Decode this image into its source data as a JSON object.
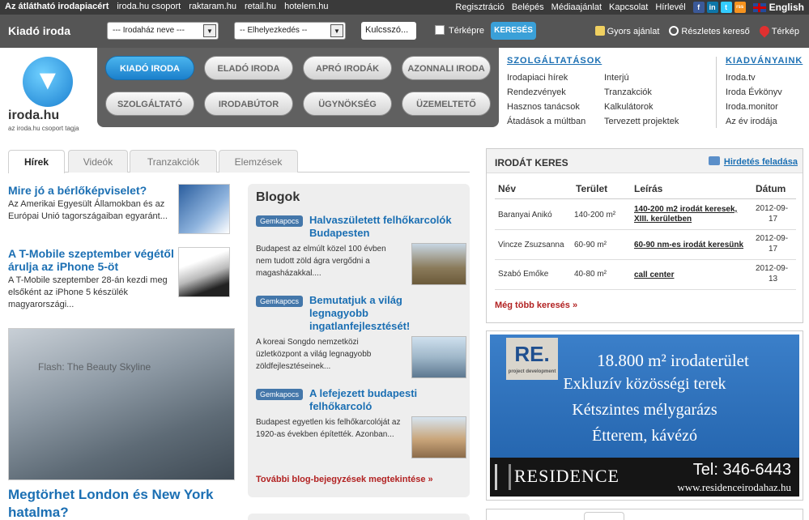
{
  "topbar": {
    "links": [
      "Az átlátható irodapiacért",
      "iroda.hu csoport",
      "raktaram.hu",
      "retail.hu",
      "hotelem.hu"
    ],
    "right": [
      "Regisztráció",
      "Belépés",
      "Médiaajánlat",
      "Kapcsolat",
      "Hírlevél"
    ],
    "social": [
      "f",
      "in",
      "t",
      "rss"
    ],
    "language": "English"
  },
  "searchbar": {
    "brand": "Kiadó iroda",
    "building_select": "--- Irodaház neve ---",
    "location_select": "-- Elhelyezkedés --",
    "keyword_placeholder": "Kulcsszó...",
    "map_checkbox": "Térképre",
    "search_button": "KERESÉS",
    "quick_offer": "Gyors ajánlat",
    "detailed_search": "Részletes kereső",
    "map": "Térkép"
  },
  "logo": {
    "name": "iroda.hu",
    "tagline": "az iroda.hu csoport tagja"
  },
  "nav": [
    "KIADÓ IRODA",
    "ELADÓ IRODA",
    "APRÓ IRODÁK",
    "AZONNALI IRODA",
    "SZOLGÁLTATÓ",
    "IRODABÚTOR",
    "ÜGYNÖKSÉG",
    "ÜZEMELTETŐ"
  ],
  "services": {
    "title": "SZOLGÁLTATÁSOK",
    "col1": [
      "Irodapiaci hírek",
      "Rendezvények",
      "Hasznos tanácsok",
      "Átadások a múltban"
    ],
    "col2": [
      "Interjú",
      "Tranzakciók",
      "Kalkulátorok",
      "Tervezett projektek"
    ]
  },
  "publications": {
    "title": "KIADVÁNYAINK",
    "items": [
      "Iroda.tv",
      "Iroda Évkönyv",
      "Iroda.monitor",
      "Az év irodája"
    ]
  },
  "tabs": [
    "Hírek",
    "Videók",
    "Tranzakciók",
    "Elemzések"
  ],
  "news": [
    {
      "title": "Mire jó a bérlőképviselet?",
      "text": "Az Amerikai Egyesült Államokban és az Európai Unió tagországaiban egyaránt..."
    },
    {
      "title": "A T-Mobile szeptember végétől árulja az iPhone 5-öt",
      "text": "A T-Mobile szeptember 28-án kezdi meg elsőként az iPhone 5 készülék magyarországi..."
    }
  ],
  "big_news": {
    "title": "Megtörhet London és New York hatalma?",
    "image_caption": "Flash: The Beauty Skyline"
  },
  "blog": {
    "heading": "Blogok",
    "tag": "Gemkapocs",
    "items": [
      {
        "title": "Halvaszületett felhőkarcolók Budapesten",
        "text": "Budapest az elmúlt közel 100 évben nem tudott zöld ágra vergődni a magasházakkal...."
      },
      {
        "title": "Bemutatjuk a világ legnagyobb ingatlanfejlesztését!",
        "text": "A koreai Songdo nemzetközi üzletközpont a világ legnagyobb zöldfejlesztéseinek..."
      },
      {
        "title": "A lefejezett budapesti felhőkarcoló",
        "text": "Budapest egyetlen kis felhőkarcolóját az 1920-as években építették. Azonban..."
      }
    ],
    "more": "További blog-bejegyzések megtekintése »"
  },
  "office_search": {
    "title": "IRODÁT KERES",
    "post_ad": "Hirdetés feladása",
    "headers": [
      "Név",
      "Terület",
      "Leírás",
      "Dátum"
    ],
    "rows": [
      {
        "name": "Baranyai Anikó",
        "area": "140-200 m²",
        "desc_line1": "140-200 m2 irodát keresek,",
        "desc_line2": "XIII. kerületben",
        "date_line1": "2012-09-",
        "date_line2": "17"
      },
      {
        "name": "Vincze Zsuzsanna",
        "area": "60-90 m²",
        "desc_line1": "60-90 nm-es irodát keresünk",
        "desc_line2": "",
        "date_line1": "2012-09-",
        "date_line2": "17"
      },
      {
        "name": "Szabó Emőke",
        "area": "40-80 m²",
        "desc_line1": "call center",
        "desc_line2": "",
        "date_line1": "2012-09-",
        "date_line2": "13"
      }
    ],
    "more": "Még több keresés »"
  },
  "ad": {
    "logo": "RE.",
    "logo_sub": "project development",
    "lines": [
      "18.800 m² irodaterület",
      "Exkluzív közösségi terek",
      "Kétszintes mélygarázs",
      "Étterem, kávézó"
    ],
    "brand": "RESIDENCE",
    "phone": "Tel: 346-6443",
    "web": "www.residenceirodahaz.hu"
  },
  "colors": {
    "accent": "#1b6fb3",
    "nav_active": "#2a95dc",
    "more_link": "#b22222"
  }
}
